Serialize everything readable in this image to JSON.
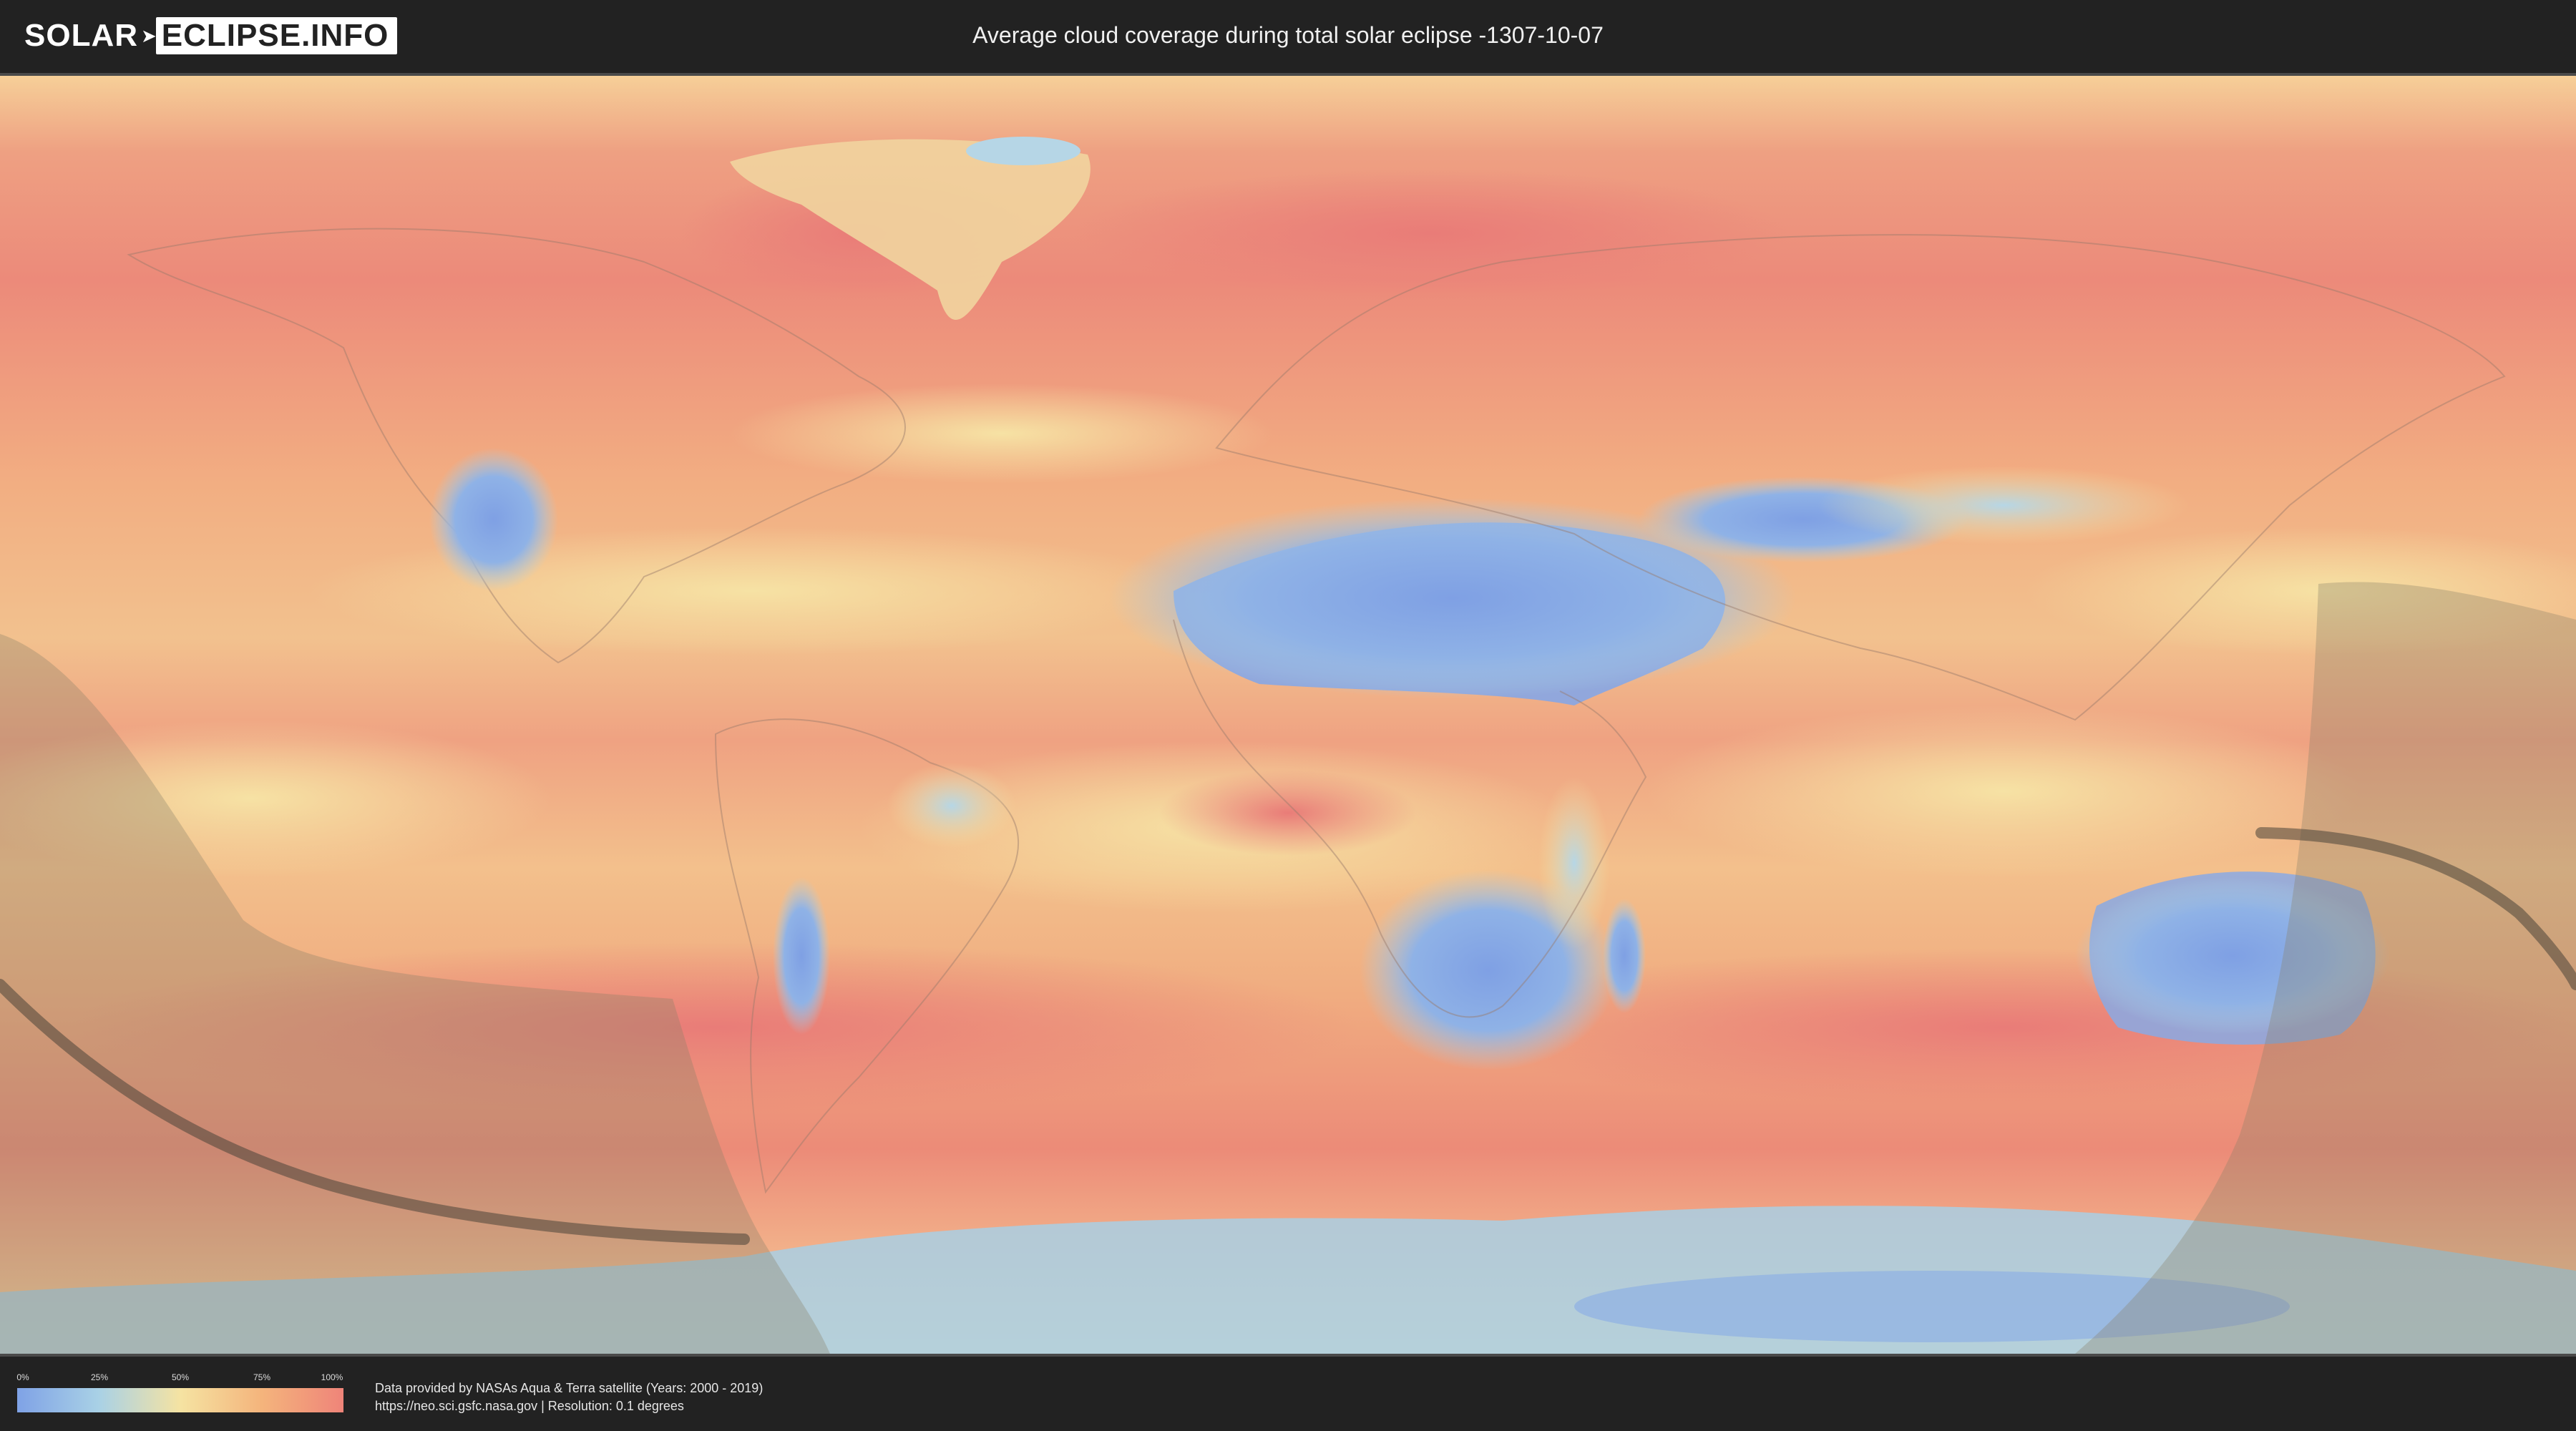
{
  "header": {
    "logo": {
      "left": "SOLAR",
      "right": "ECLIPSE.INFO"
    },
    "title": "Average cloud coverage during total solar eclipse -1307-10-07"
  },
  "map": {
    "icon": "world-cloud-coverage-map",
    "colors": {
      "clear": "#7fa2e6",
      "light": "#a9d1e6",
      "medium": "#f5e3a2",
      "heavy": "#f4b47c",
      "overcast": "#ef8479",
      "visibility_shadow": "#8a7e66",
      "central_line": "#4b4438"
    }
  },
  "legend": {
    "ticks": [
      "0%",
      "25%",
      "50%",
      "75%",
      "100%"
    ]
  },
  "footer": {
    "credit_line1": "Data provided by NASAs Aqua & Terra satellite (Years: 2000 - 2019)",
    "credit_line2": "https://neo.sci.gsfc.nasa.gov | Resolution: 0.1 degrees"
  }
}
